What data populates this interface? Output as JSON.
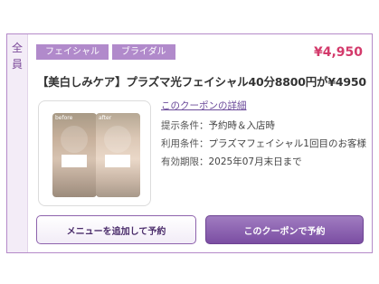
{
  "side_tab": {
    "chars": [
      "全",
      "員"
    ]
  },
  "tags": [
    "フェイシャル",
    "ブライダル"
  ],
  "price": "¥4,950",
  "title": "【美白しみケア】プラズマ光フェイシャル40分8800円が¥4950",
  "photos": {
    "before_label": "before",
    "after_label": "after"
  },
  "details": {
    "link": "このクーポンの詳細",
    "rows": [
      {
        "key": "提示条件：",
        "value": "予約時＆入店時"
      },
      {
        "key": "利用条件：",
        "value": "プラズマフェイシャル1回目のお客様"
      },
      {
        "key": "有効期限：",
        "value": "2025年07月末日まで"
      }
    ]
  },
  "buttons": {
    "add_menu": "メニューを追加して予約",
    "book_coupon": "このクーポンで予約"
  },
  "colors": {
    "accent": "#b18acb",
    "price": "#d33a6b",
    "primary": "#7b4ea3"
  }
}
